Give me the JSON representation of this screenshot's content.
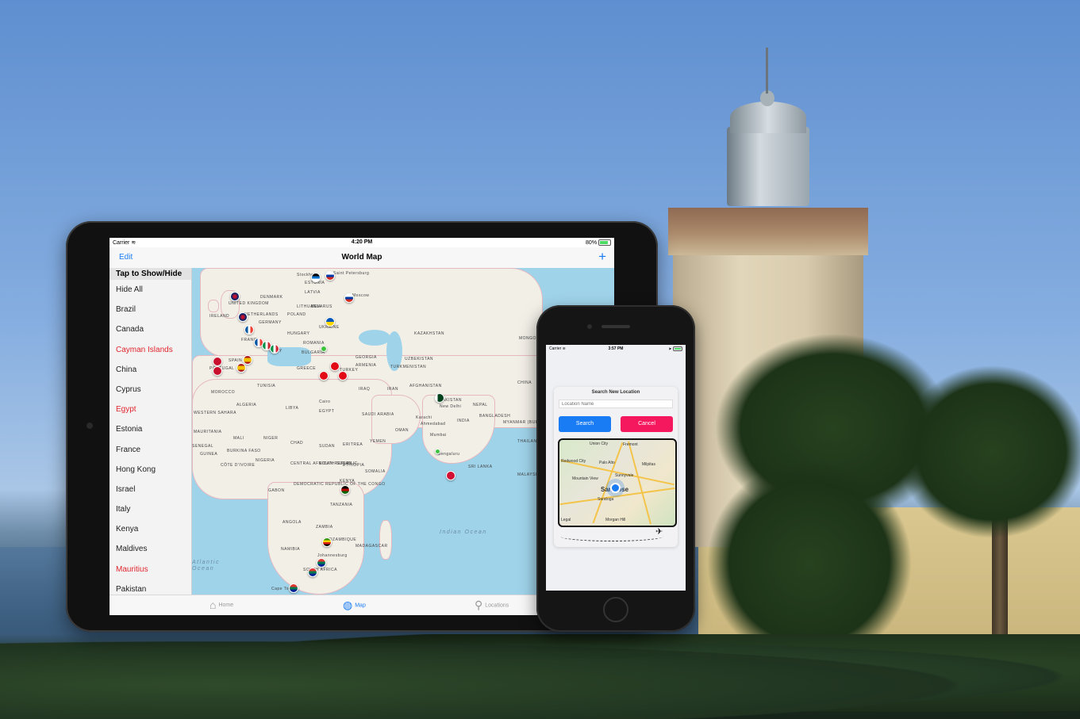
{
  "ipad": {
    "status": {
      "carrier": "Carrier",
      "time": "4:20 PM",
      "battery": "80%",
      "battery_level": 0.8
    },
    "nav": {
      "edit_label": "Edit",
      "title": "World Map",
      "add_label": "+"
    },
    "sidebar": {
      "header": "Tap to Show/Hide",
      "items": [
        {
          "label": "Hide All",
          "hidden": false
        },
        {
          "label": "Brazil",
          "hidden": false
        },
        {
          "label": "Canada",
          "hidden": false
        },
        {
          "label": "Cayman Islands",
          "hidden": true
        },
        {
          "label": "China",
          "hidden": false
        },
        {
          "label": "Cyprus",
          "hidden": false
        },
        {
          "label": "Egypt",
          "hidden": true
        },
        {
          "label": "Estonia",
          "hidden": false
        },
        {
          "label": "France",
          "hidden": false
        },
        {
          "label": "Hong Kong",
          "hidden": false
        },
        {
          "label": "Israel",
          "hidden": false
        },
        {
          "label": "Italy",
          "hidden": false
        },
        {
          "label": "Kenya",
          "hidden": false
        },
        {
          "label": "Maldives",
          "hidden": false
        },
        {
          "label": "Mauritius",
          "hidden": true
        },
        {
          "label": "Pakistan",
          "hidden": false
        }
      ]
    },
    "map": {
      "labels": [
        "Stockholm",
        "Saint Petersburg",
        "ESTONIA",
        "DENMARK",
        "LATVIA",
        "LITHUANIA",
        "Moscow",
        "UNITED KINGDOM",
        "BELARUS",
        "IRELAND",
        "NETHERLANDS",
        "POLAND",
        "GERMANY",
        "UKRAINE",
        "KAZAKHSTAN",
        "HUNGARY",
        "FRANCE",
        "ROMANIA",
        "BULGARIA",
        "ITALY",
        "SPAIN",
        "PORTUGAL",
        "GEORGIA",
        "UZBEKISTAN",
        "GREECE",
        "TURKEY",
        "ARMENIA",
        "TURKMENISTAN",
        "MONGOLIA",
        "TUNISIA",
        "IRAN",
        "AFGHANISTAN",
        "MOROCCO",
        "IRAQ",
        "CHINA",
        "ALGERIA",
        "LIBYA",
        "PAKISTAN",
        "Cairo",
        "EGYPT",
        "SAUDI ARABIA",
        "New Delhi",
        "NEPAL",
        "WESTERN SAHARA",
        "Karachi",
        "Ahmedabad",
        "BANGLADESH",
        "MYANMAR (BURMA)",
        "MAURITANIA",
        "MALI",
        "NIGER",
        "OMAN",
        "INDIA",
        "SENEGAL",
        "CHAD",
        "SUDAN",
        "ERITREA",
        "YEMEN",
        "Mumbai",
        "THAILAND",
        "GUINEA",
        "BURKINA FASO",
        "NIGERIA",
        "CÔTE D'IVOIRE",
        "CENTRAL AFRICAN REPUBLIC",
        "SOUTH SUDAN",
        "ETHIOPIA",
        "SOMALIA",
        "Bengaluru",
        "SRI LANKA",
        "DEMOCRATIC REPUBLIC OF THE CONGO",
        "KENYA",
        "GABON",
        "TANZANIA",
        "MALAYSIA",
        "ANGOLA",
        "ZAMBIA",
        "MOZAMBIQUE",
        "NAMIBIA",
        "MADAGASCAR",
        "Johannesburg",
        "SOUTH AFRICA",
        "Cape Town"
      ],
      "oceans": [
        "Indian Ocean",
        "Atlantic Ocean"
      ]
    },
    "tabs": [
      {
        "label": "Home",
        "icon": "home-icon"
      },
      {
        "label": "Map",
        "icon": "globe-icon"
      },
      {
        "label": "Locations",
        "icon": "location-pin-icon"
      }
    ]
  },
  "iphone": {
    "status": {
      "carrier": "Carrier",
      "time": "3:57 PM"
    },
    "dialog": {
      "title": "Search New Location",
      "placeholder": "Location Name",
      "search_label": "Search",
      "cancel_label": "Cancel"
    },
    "mini_map": {
      "labels": [
        "Union City",
        "Fremont",
        "Redwood City",
        "Palo Alto",
        "Milpitas",
        "Mountain View",
        "Sunnyvale",
        "San Jose",
        "Saratoga",
        "Morgan Hill",
        "Legal"
      ]
    }
  },
  "colors": {
    "accent": "#1a7cf5",
    "cancel": "#f5185f",
    "hidden_item": "#e0262f"
  }
}
